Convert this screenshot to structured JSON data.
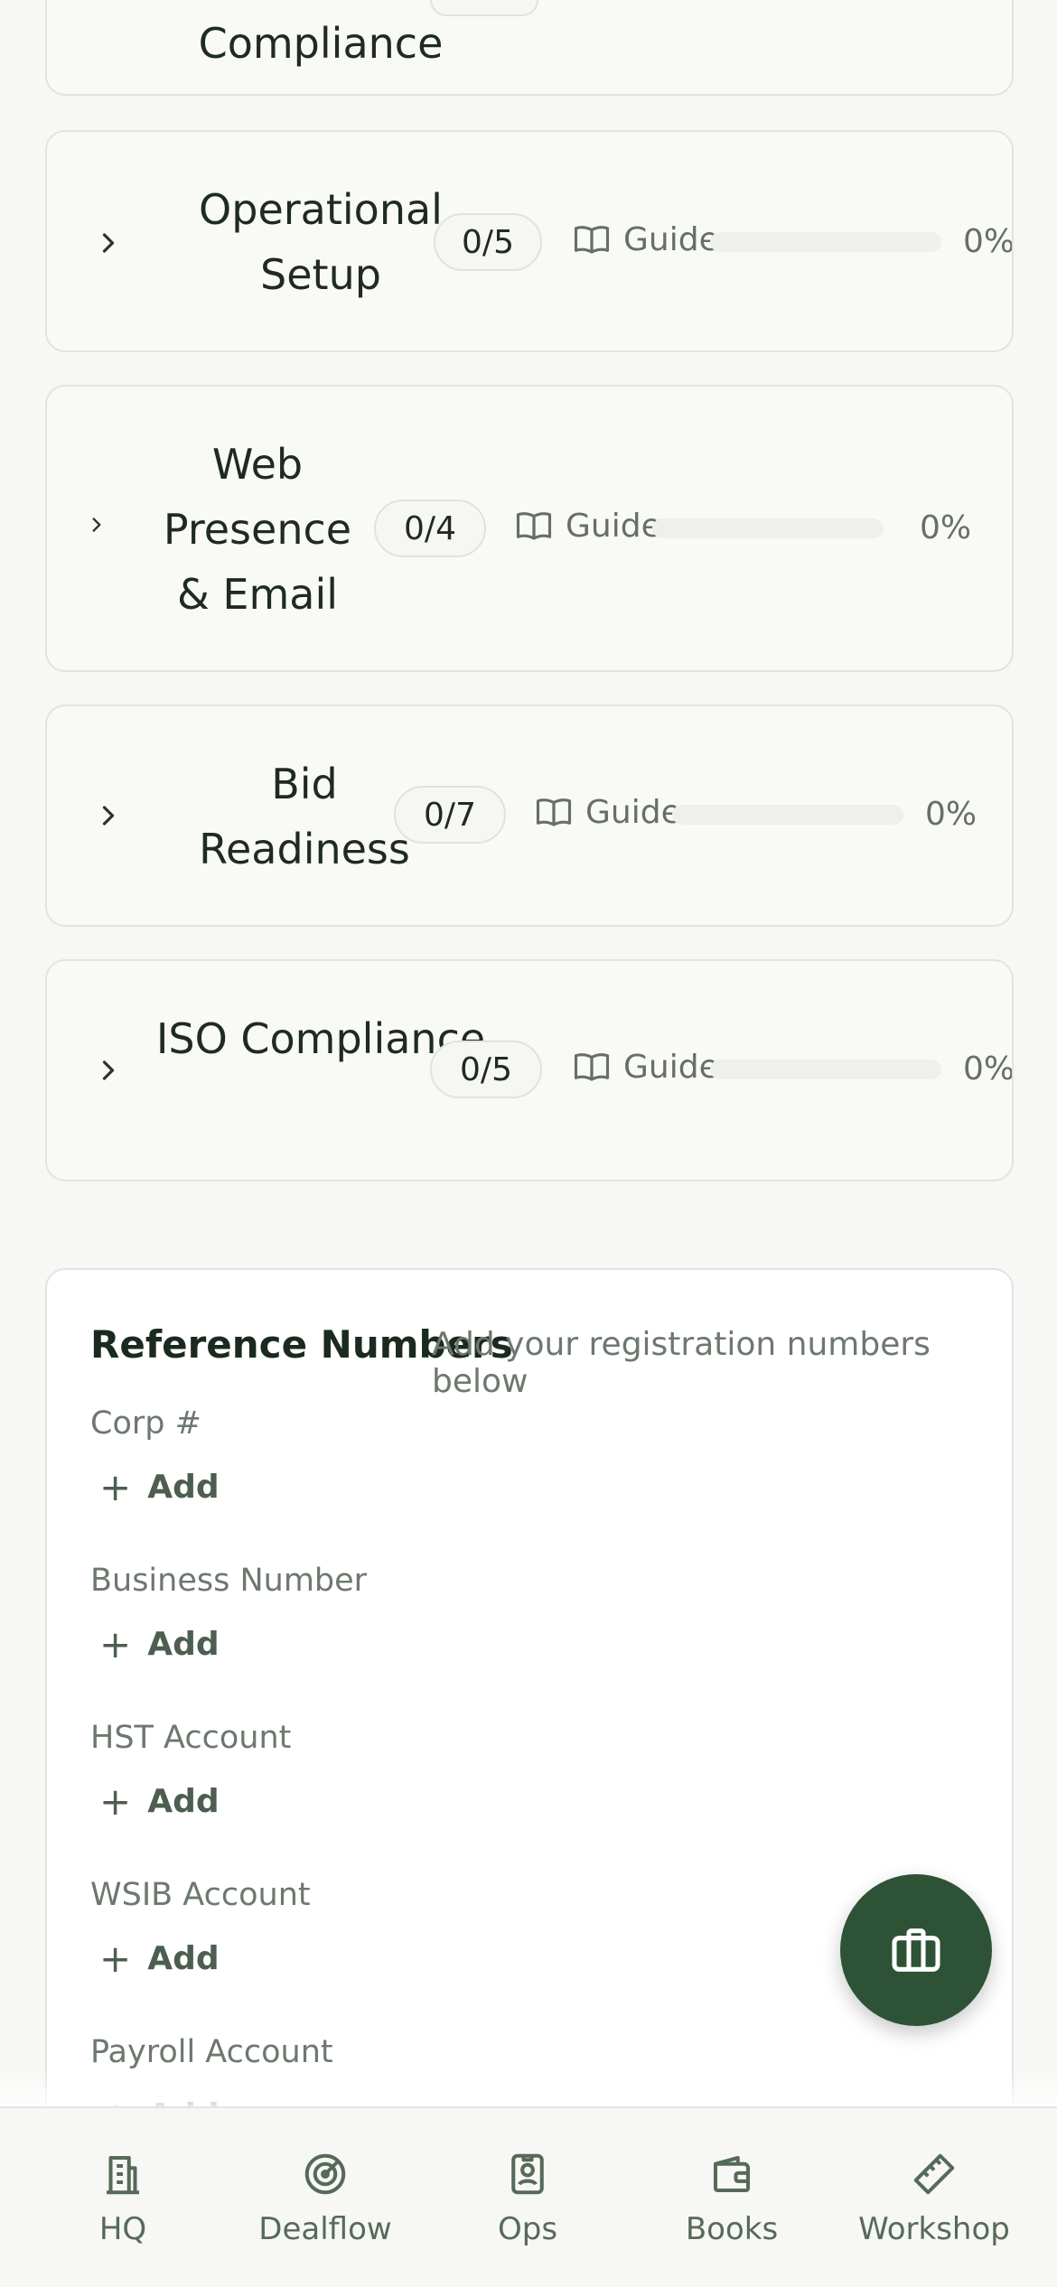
{
  "partial_card": {
    "title": "Compliance"
  },
  "sections": [
    {
      "title": "Operational Setup",
      "count": "0/5",
      "guide": "Guide",
      "progress_pct": 0,
      "pct_label": "0%"
    },
    {
      "title": "Web Presence & Email",
      "count": "0/4",
      "guide": "Guide",
      "progress_pct": 0,
      "pct_label": "0%"
    },
    {
      "title": "Bid Readiness",
      "count": "0/7",
      "guide": "Guide",
      "progress_pct": 0,
      "pct_label": "0%"
    },
    {
      "title": "ISO Compliance",
      "count": "0/5",
      "guide": "Guide",
      "progress_pct": 0,
      "pct_label": "0%"
    }
  ],
  "reference": {
    "title": "Reference Numbers",
    "subtitle": "Add your registration numbers below",
    "add_label": "Add",
    "fields": [
      {
        "label": "Corp #"
      },
      {
        "label": "Business Number"
      },
      {
        "label": "HST Account"
      },
      {
        "label": "WSIB Account"
      },
      {
        "label": "Payroll Account"
      }
    ]
  },
  "fab": {
    "icon": "briefcase-icon"
  },
  "tabs": [
    {
      "label": "HQ",
      "icon": "building-icon"
    },
    {
      "label": "Dealflow",
      "icon": "radar-icon"
    },
    {
      "label": "Ops",
      "icon": "id-badge-icon"
    },
    {
      "label": "Books",
      "icon": "wallet-icon"
    },
    {
      "label": "Workshop",
      "icon": "ruler-icon"
    }
  ],
  "colors": {
    "accent": "#2d5236",
    "muted_text": "#6d786e",
    "tab_text": "#566a59"
  }
}
